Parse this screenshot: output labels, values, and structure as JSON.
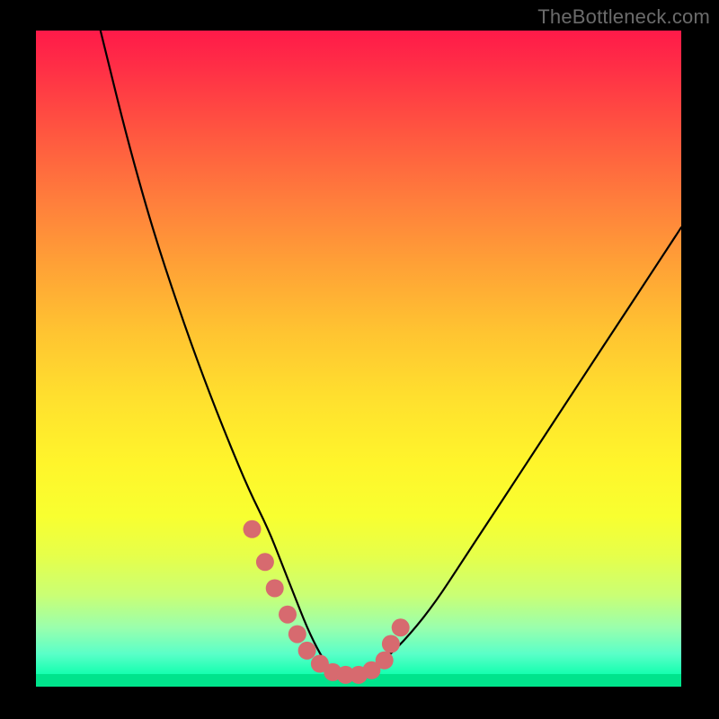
{
  "watermark": "TheBottleneck.com",
  "chart_data": {
    "type": "line",
    "title": "",
    "xlabel": "",
    "ylabel": "",
    "xlim": [
      0,
      100
    ],
    "ylim": [
      0,
      100
    ],
    "series": [
      {
        "name": "curve",
        "x": [
          10,
          14,
          18,
          22,
          26,
          30,
          33,
          36,
          38,
          40,
          42,
          44,
          46,
          50,
          54,
          58,
          62,
          66,
          70,
          74,
          78,
          82,
          86,
          90,
          94,
          98,
          100
        ],
        "y": [
          100,
          84,
          70,
          58,
          47,
          37,
          30,
          24,
          19,
          14,
          9,
          5,
          2,
          2,
          4,
          8,
          13,
          19,
          25,
          31,
          37,
          43,
          49,
          55,
          61,
          67,
          70
        ]
      }
    ],
    "markers": {
      "name": "highlight-points",
      "color": "#d76a6f",
      "x": [
        33.5,
        35.5,
        37.0,
        39.0,
        40.5,
        42.0,
        44.0,
        46.0,
        48.0,
        50.0,
        52.0,
        54.0,
        55.0,
        56.5
      ],
      "y": [
        24.0,
        19.0,
        15.0,
        11.0,
        8.0,
        5.5,
        3.5,
        2.2,
        1.8,
        1.8,
        2.5,
        4.0,
        6.5,
        9.0
      ]
    }
  },
  "colors": {
    "background": "#000000",
    "curve": "#000000",
    "marker": "#d76a6f"
  }
}
